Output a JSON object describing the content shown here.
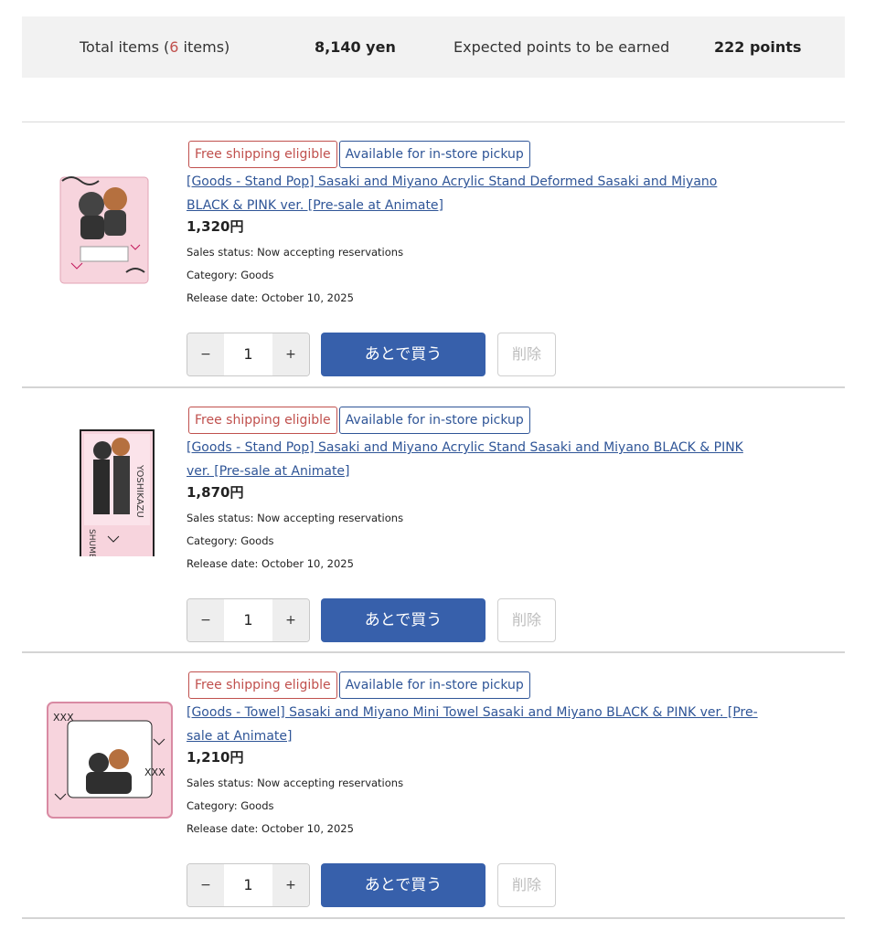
{
  "summary": {
    "total_prefix": "Total items (",
    "total_count": "6",
    "total_suffix": " items)",
    "amount": "8,140 yen",
    "points_label": "Expected points to be earned",
    "points": "222 points"
  },
  "colors": {
    "badge_free": "#c0504d",
    "badge_pickup": "#2f5597",
    "primary_button": "#3760ab",
    "summary_bg": "#f2f2f2",
    "thumb_pink": "#f4c6d3"
  },
  "items": [
    {
      "badge_free": "Free shipping eligible",
      "badge_pickup": "Available for in-store pickup",
      "title": "[Goods - Stand Pop] Sasaki and Miyano Acrylic Stand Deformed Sasaki and Miyano BLACK & PINK ver. [Pre-sale at Animate]",
      "price": "1,320円",
      "status": "Sales status: Now accepting reservations",
      "category": "Category: Goods",
      "release": "Release date: October 10, 2025",
      "minus": "−",
      "qty": "1",
      "plus": "+",
      "later": "あとで買う",
      "delete": "削除",
      "thumb_icon": "acrylic-stand-image"
    },
    {
      "badge_free": "Free shipping eligible",
      "badge_pickup": "Available for in-store pickup",
      "title": "[Goods - Stand Pop] Sasaki and Miyano Acrylic Stand Sasaki and Miyano BLACK & PINK ver. [Pre-sale at Animate]",
      "price": "1,870円",
      "status": "Sales status: Now accepting reservations",
      "category": "Category: Goods",
      "release": "Release date: October 10, 2025",
      "minus": "−",
      "qty": "1",
      "plus": "+",
      "later": "あとで買う",
      "delete": "削除",
      "thumb_icon": "tall-acrylic-stand-image"
    },
    {
      "badge_free": "Free shipping eligible",
      "badge_pickup": "Available for in-store pickup",
      "title": "[Goods - Towel] Sasaki and Miyano Mini Towel Sasaki and Miyano BLACK & PINK ver. [Pre-sale at Animate]",
      "price": "1,210円",
      "status": "Sales status: Now accepting reservations",
      "category": "Category: Goods",
      "release": "Release date: October 10, 2025",
      "minus": "−",
      "qty": "1",
      "plus": "+",
      "later": "あとで買う",
      "delete": "削除",
      "thumb_icon": "mini-towel-image"
    }
  ]
}
